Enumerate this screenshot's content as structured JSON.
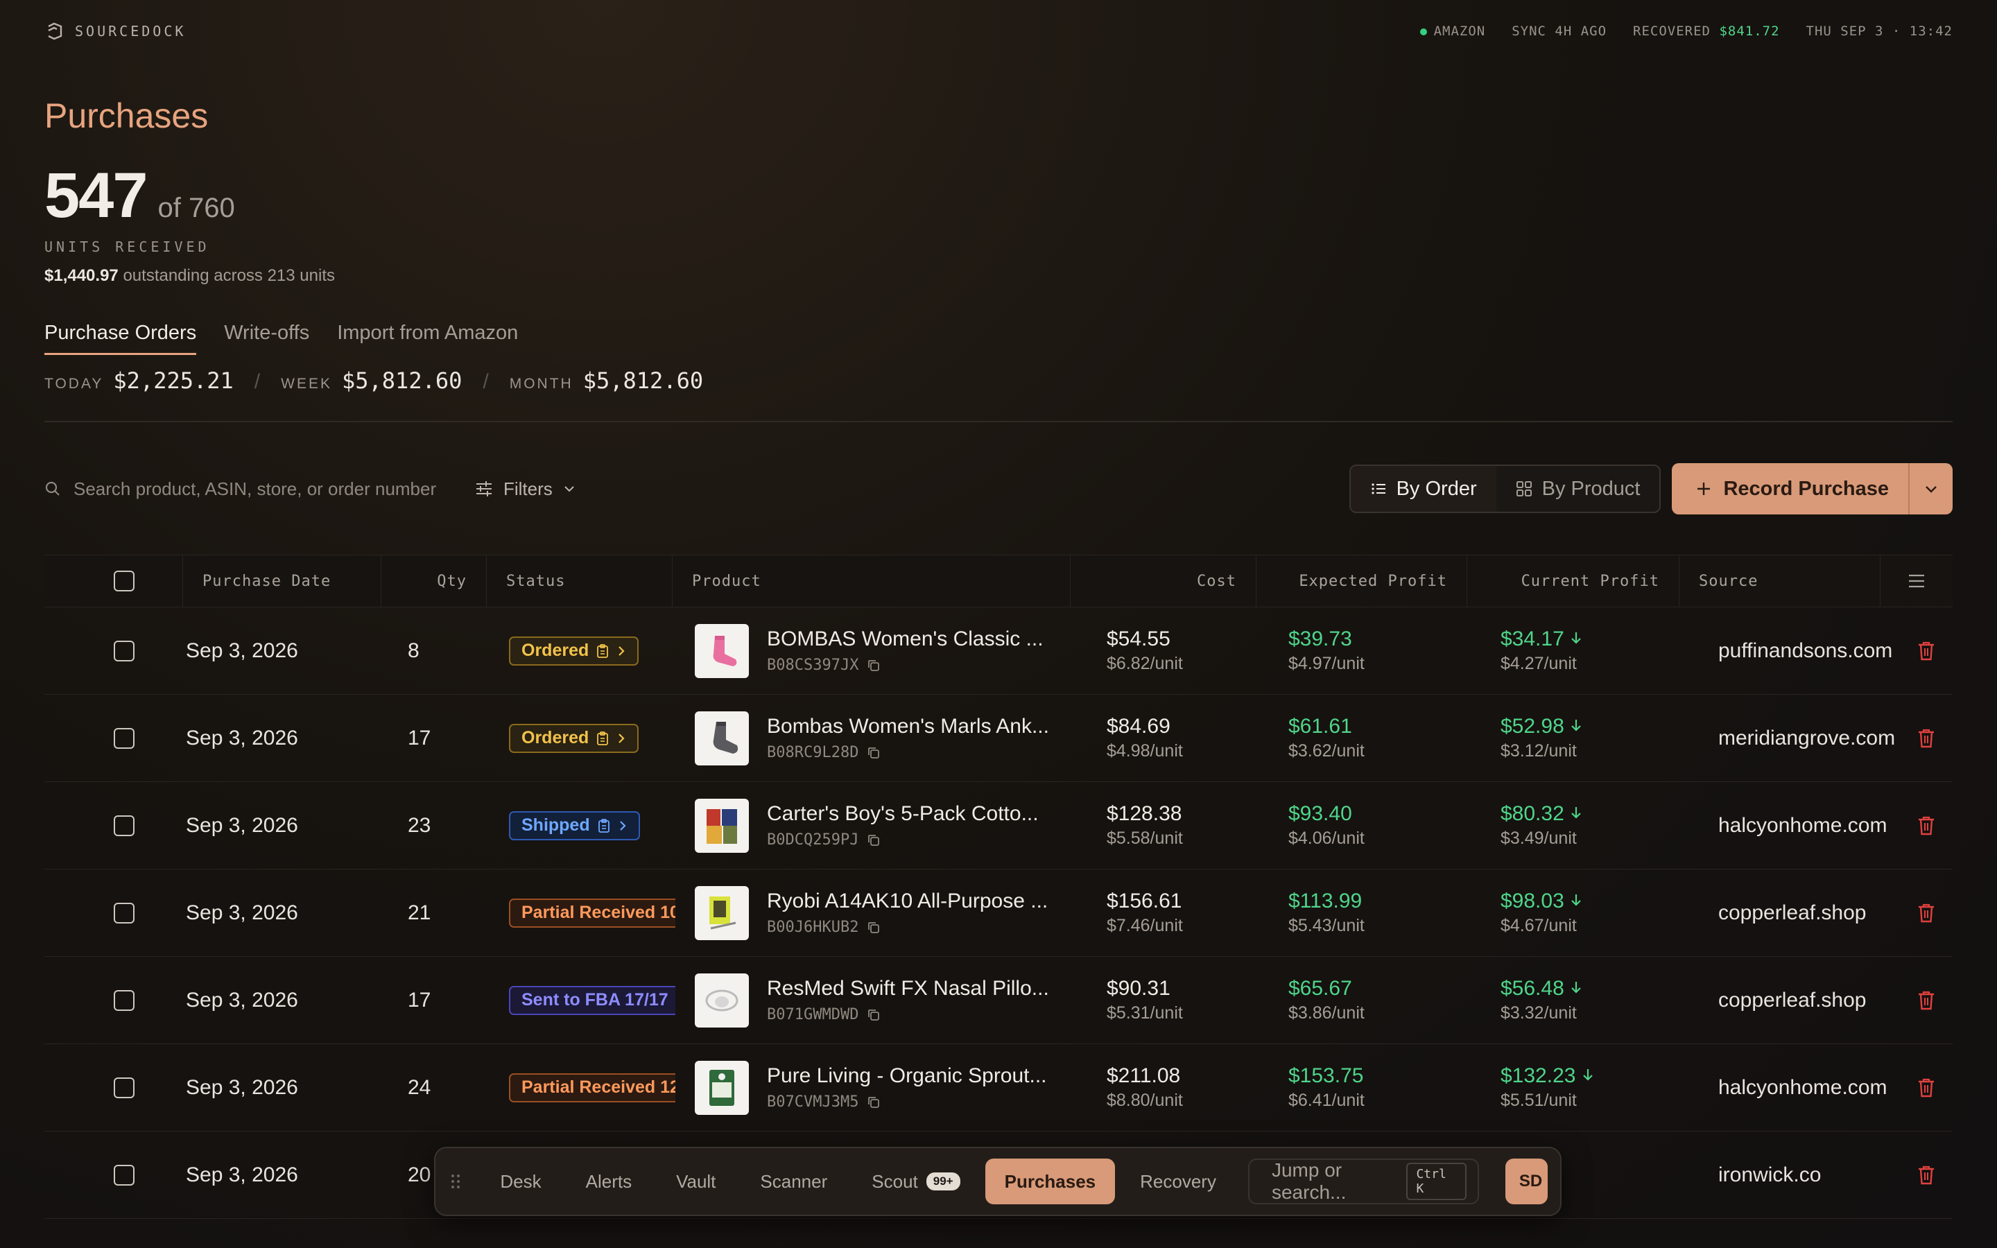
{
  "brand": {
    "name": "SOURCEDOCK"
  },
  "statusbar": {
    "marketplace": "AMAZON",
    "sync": "SYNC 4H AGO",
    "recovered_label": "RECOVERED",
    "recovered_value": "$841.72",
    "datetime": "THU SEP 3 · 13:42"
  },
  "header": {
    "title": "Purchases",
    "units_received": "547",
    "units_total": "of 760",
    "units_label": "UNITS RECEIVED",
    "outstanding_amount": "$1,440.97",
    "outstanding_text": "outstanding across 213 units"
  },
  "tabs": [
    {
      "label": "Purchase Orders",
      "active": true
    },
    {
      "label": "Write-offs",
      "active": false
    },
    {
      "label": "Import from Amazon",
      "active": false
    }
  ],
  "totals": {
    "today_label": "TODAY",
    "today_value": "$2,225.21",
    "week_label": "WEEK",
    "week_value": "$5,812.60",
    "month_label": "MONTH",
    "month_value": "$5,812.60",
    "separator": "/"
  },
  "toolbar": {
    "search_placeholder": "Search product, ASIN, store, or order number",
    "filters_label": "Filters",
    "by_order_label": "By Order",
    "by_product_label": "By Product",
    "record_label": "Record Purchase"
  },
  "table": {
    "columns": {
      "date": "Purchase Date",
      "qty": "Qty",
      "status": "Status",
      "product": "Product",
      "cost": "Cost",
      "expected": "Expected Profit",
      "current": "Current Profit",
      "source": "Source"
    },
    "rows": [
      {
        "date": "Sep 3, 2026",
        "qty": "8",
        "status": "Ordered",
        "status_type": "ordered",
        "product": "BOMBAS Women's Classic ...",
        "asin": "B08CS397JX",
        "cost": "$54.55",
        "cost_unit": "$6.82/unit",
        "exp": "$39.73",
        "exp_unit": "$4.97/unit",
        "cur": "$34.17",
        "cur_unit": "$4.27/unit",
        "source": "puffinandsons.com",
        "thumb": "sock-pink"
      },
      {
        "date": "Sep 3, 2026",
        "qty": "17",
        "status": "Ordered",
        "status_type": "ordered",
        "product": "Bombas Women's Marls Ank...",
        "asin": "B08RC9L28D",
        "cost": "$84.69",
        "cost_unit": "$4.98/unit",
        "exp": "$61.61",
        "exp_unit": "$3.62/unit",
        "cur": "$52.98",
        "cur_unit": "$3.12/unit",
        "source": "meridiangrove.com",
        "thumb": "sock-grey"
      },
      {
        "date": "Sep 3, 2026",
        "qty": "23",
        "status": "Shipped",
        "status_type": "shipped",
        "product": "Carter's Boy's 5-Pack Cotto...",
        "asin": "B0DCQ259PJ",
        "cost": "$128.38",
        "cost_unit": "$5.58/unit",
        "exp": "$93.40",
        "exp_unit": "$4.06/unit",
        "cur": "$80.32",
        "cur_unit": "$3.49/unit",
        "source": "halcyonhome.com",
        "thumb": "clothes"
      },
      {
        "date": "Sep 3, 2026",
        "qty": "21",
        "status": "Partial Received 10",
        "status_type": "partial",
        "product": "Ryobi A14AK10 All-Purpose ...",
        "asin": "B00J6HKUB2",
        "cost": "$156.61",
        "cost_unit": "$7.46/unit",
        "exp": "$113.99",
        "exp_unit": "$5.43/unit",
        "cur": "$98.03",
        "cur_unit": "$4.67/unit",
        "source": "copperleaf.shop",
        "thumb": "tool"
      },
      {
        "date": "Sep 3, 2026",
        "qty": "17",
        "status": "Sent to FBA 17/17",
        "status_type": "fba",
        "product": "ResMed Swift FX Nasal Pillo...",
        "asin": "B071GWMDWD",
        "cost": "$90.31",
        "cost_unit": "$5.31/unit",
        "exp": "$65.67",
        "exp_unit": "$3.86/unit",
        "cur": "$56.48",
        "cur_unit": "$3.32/unit",
        "source": "copperleaf.shop",
        "thumb": "mask"
      },
      {
        "date": "Sep 3, 2026",
        "qty": "24",
        "status": "Partial Received 12",
        "status_type": "partial",
        "product": "Pure Living - Organic Sprout...",
        "asin": "B07CVMJ3M5",
        "cost": "$211.08",
        "cost_unit": "$8.80/unit",
        "exp": "$153.75",
        "exp_unit": "$6.41/unit",
        "cur": "$132.23",
        "cur_unit": "$5.51/unit",
        "source": "halcyonhome.com",
        "thumb": "bag"
      },
      {
        "date": "Sep 3, 2026",
        "qty": "20",
        "status": "",
        "status_type": "",
        "product": "",
        "asin": "",
        "cost": "",
        "cost_unit": "",
        "exp": "",
        "exp_unit": "",
        "cur": "",
        "cur_unit": "",
        "source": "ironwick.co",
        "thumb": ""
      }
    ]
  },
  "dock": {
    "items": [
      {
        "label": "Desk",
        "active": false
      },
      {
        "label": "Alerts",
        "active": false
      },
      {
        "label": "Vault",
        "active": false
      },
      {
        "label": "Scanner",
        "active": false
      },
      {
        "label": "Scout",
        "active": false,
        "badge": "99+"
      },
      {
        "label": "Purchases",
        "active": true
      },
      {
        "label": "Recovery",
        "active": false
      }
    ],
    "jump_placeholder": "Jump or search...",
    "shortcut": "Ctrl K",
    "avatar": "SD"
  },
  "colors": {
    "accent": "#d89a78",
    "profit": "#4fd58a",
    "danger": "#e0413f"
  }
}
